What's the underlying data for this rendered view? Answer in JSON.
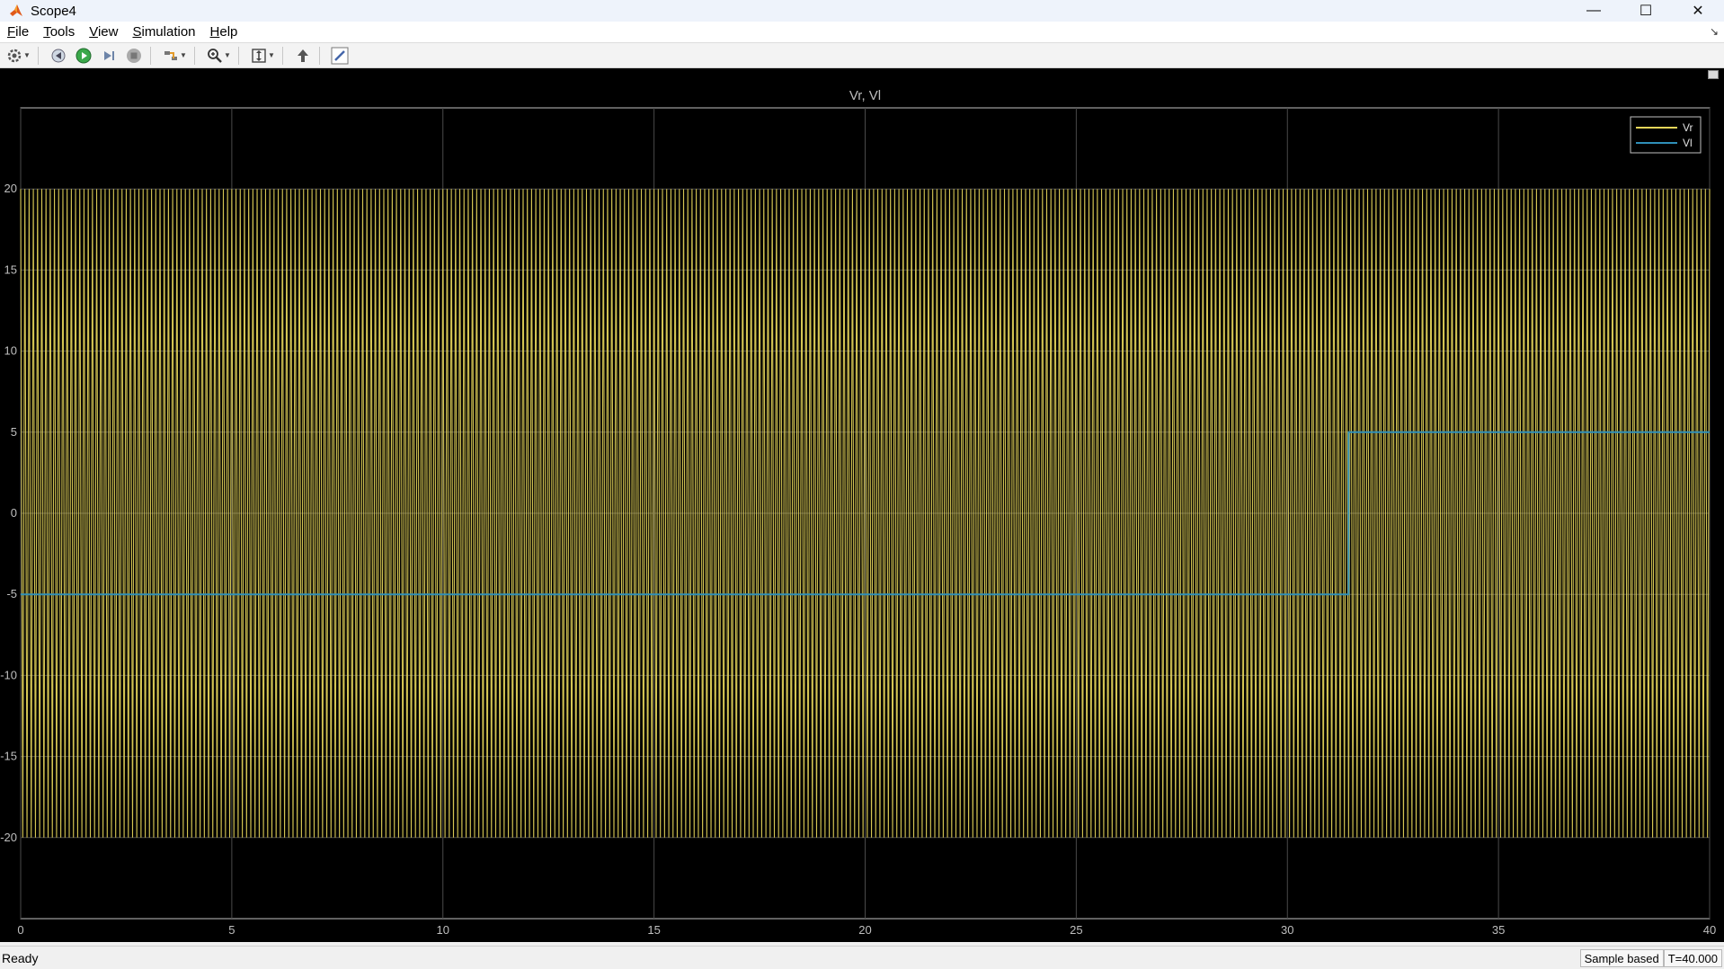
{
  "window": {
    "title": "Scope4",
    "minimize": "—",
    "maximize": "☐",
    "close": "✕"
  },
  "menu": {
    "file": "File",
    "tools": "Tools",
    "view": "View",
    "simulation": "Simulation",
    "help": "Help"
  },
  "toolbar": {
    "icons": [
      "settings-icon",
      "step-back-icon",
      "run-icon",
      "step-forward-icon",
      "stop-icon",
      "highlight-signal-icon",
      "zoom-icon",
      "autoscale-icon",
      "bring-forward-icon",
      "edit-icon"
    ]
  },
  "status": {
    "left": "Ready",
    "mode": "Sample based",
    "time": "T=40.000"
  },
  "chart_data": {
    "type": "line",
    "title": "Vr, Vl",
    "xlabel": "",
    "ylabel": "",
    "xlim": [
      0,
      40
    ],
    "ylim": [
      -25,
      25
    ],
    "xticks": [
      "0",
      "5",
      "10",
      "15",
      "20",
      "25",
      "30",
      "35",
      "40"
    ],
    "yticks": [
      "20",
      "15",
      "10",
      "5",
      "0",
      "-5",
      "-10",
      "-15",
      "-20"
    ],
    "grid": true,
    "legend": "top-right",
    "series": [
      {
        "name": "Vr",
        "color": "#e6d65a",
        "kind": "sine",
        "amplitude": 20,
        "offset": 0,
        "x": [
          0,
          40
        ],
        "note_visible": "dense oscillation between -20 and 20 across full range"
      },
      {
        "name": "Vl",
        "color": "#2f8fb8",
        "kind": "step",
        "x": [
          0,
          31.45,
          31.45,
          40
        ],
        "y": [
          -5,
          -5,
          5,
          5
        ]
      }
    ],
    "background": "#000000",
    "axis_color": "#bfbfbf"
  }
}
